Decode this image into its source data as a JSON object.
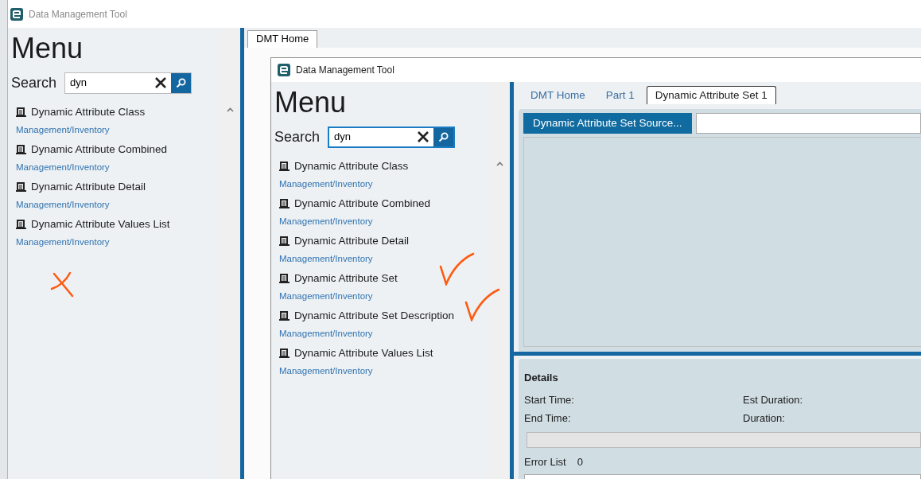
{
  "outer_window": {
    "title": "Data Management Tool",
    "menu": {
      "heading": "Menu",
      "search_label": "Search",
      "search_value": "dyn",
      "cross_mark": true,
      "items": [
        {
          "title": "Dynamic Attribute Class",
          "path": "Management/Inventory"
        },
        {
          "title": "Dynamic Attribute Combined",
          "path": "Management/Inventory"
        },
        {
          "title": "Dynamic Attribute Detail",
          "path": "Management/Inventory"
        },
        {
          "title": "Dynamic Attribute Values List",
          "path": "Management/Inventory"
        }
      ]
    },
    "tabs": [
      {
        "label": "DMT Home",
        "selected": true
      }
    ]
  },
  "inner_window": {
    "title": "Data Management Tool",
    "menu": {
      "heading": "Menu",
      "search_label": "Search",
      "search_value": "dyn",
      "items": [
        {
          "title": "Dynamic Attribute Class",
          "path": "Management/Inventory"
        },
        {
          "title": "Dynamic Attribute Combined",
          "path": "Management/Inventory"
        },
        {
          "title": "Dynamic Attribute Detail",
          "path": "Management/Inventory"
        },
        {
          "title": "Dynamic Attribute Set",
          "path": "Management/Inventory",
          "check_mark": true
        },
        {
          "title": "Dynamic Attribute Set Description",
          "path": "Management/Inventory",
          "check_mark": true
        },
        {
          "title": "Dynamic Attribute Values List",
          "path": "Management/Inventory"
        }
      ]
    },
    "tabs": [
      {
        "label": "DMT Home",
        "selected": false
      },
      {
        "label": "Part 1",
        "selected": false
      },
      {
        "label": "Dynamic Attribute Set 1",
        "selected": true
      }
    ],
    "source_button": "Dynamic Attribute Set Source...",
    "details": {
      "heading": "Details",
      "fields": [
        "Start Time:",
        "Est Duration:",
        "End Time:",
        "Duration:"
      ],
      "progress": {
        "level": 0
      },
      "error_label": "Error List",
      "error_count": "0"
    }
  }
}
